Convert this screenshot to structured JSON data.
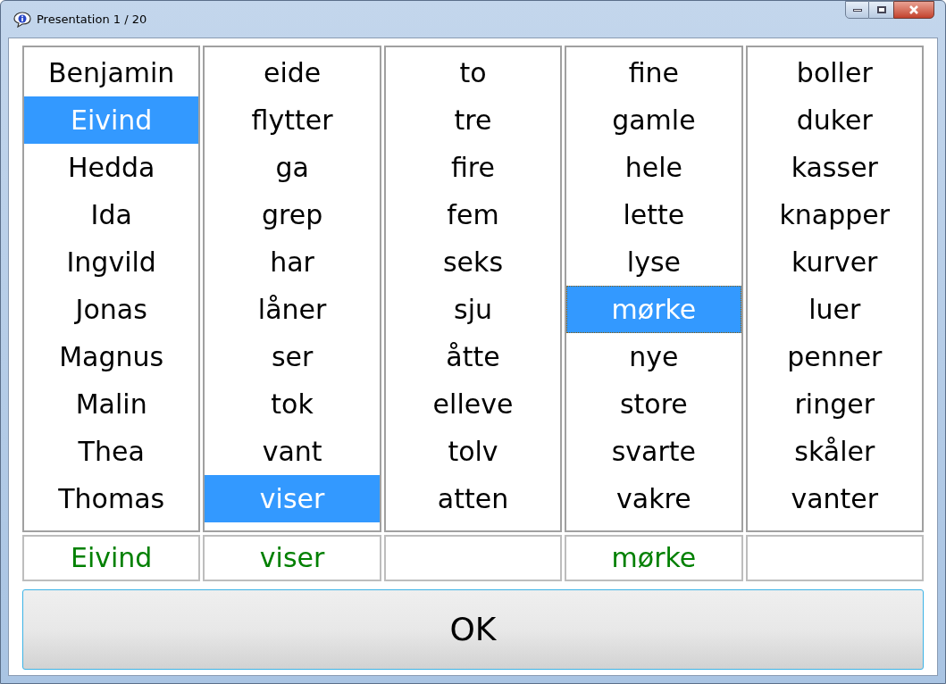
{
  "window": {
    "title": "Presentation 1 / 20"
  },
  "columns": [
    {
      "items": [
        {
          "text": "Benjamin",
          "selected": false,
          "focused": false
        },
        {
          "text": "Eivind",
          "selected": true,
          "focused": false
        },
        {
          "text": "Hedda",
          "selected": false,
          "focused": false
        },
        {
          "text": "Ida",
          "selected": false,
          "focused": false
        },
        {
          "text": "Ingvild",
          "selected": false,
          "focused": false
        },
        {
          "text": "Jonas",
          "selected": false,
          "focused": false
        },
        {
          "text": "Magnus",
          "selected": false,
          "focused": false
        },
        {
          "text": "Malin",
          "selected": false,
          "focused": false
        },
        {
          "text": "Thea",
          "selected": false,
          "focused": false
        },
        {
          "text": "Thomas",
          "selected": false,
          "focused": false
        }
      ],
      "answer": "Eivind"
    },
    {
      "items": [
        {
          "text": "eide",
          "selected": false,
          "focused": false
        },
        {
          "text": "flytter",
          "selected": false,
          "focused": false
        },
        {
          "text": "ga",
          "selected": false,
          "focused": false
        },
        {
          "text": "grep",
          "selected": false,
          "focused": false
        },
        {
          "text": "har",
          "selected": false,
          "focused": false
        },
        {
          "text": "låner",
          "selected": false,
          "focused": false
        },
        {
          "text": "ser",
          "selected": false,
          "focused": false
        },
        {
          "text": "tok",
          "selected": false,
          "focused": false
        },
        {
          "text": "vant",
          "selected": false,
          "focused": false
        },
        {
          "text": "viser",
          "selected": true,
          "focused": false
        }
      ],
      "answer": "viser"
    },
    {
      "items": [
        {
          "text": "to",
          "selected": false,
          "focused": false
        },
        {
          "text": "tre",
          "selected": false,
          "focused": false
        },
        {
          "text": "fire",
          "selected": false,
          "focused": false
        },
        {
          "text": "fem",
          "selected": false,
          "focused": false
        },
        {
          "text": "seks",
          "selected": false,
          "focused": false
        },
        {
          "text": "sju",
          "selected": false,
          "focused": false
        },
        {
          "text": "åtte",
          "selected": false,
          "focused": false
        },
        {
          "text": "elleve",
          "selected": false,
          "focused": false
        },
        {
          "text": "tolv",
          "selected": false,
          "focused": false
        },
        {
          "text": "atten",
          "selected": false,
          "focused": false
        }
      ]
    },
    {
      "items": [
        {
          "text": "fine",
          "selected": false,
          "focused": false
        },
        {
          "text": "gamle",
          "selected": false,
          "focused": false
        },
        {
          "text": "hele",
          "selected": false,
          "focused": false
        },
        {
          "text": "lette",
          "selected": false,
          "focused": false
        },
        {
          "text": "lyse",
          "selected": false,
          "focused": false
        },
        {
          "text": "mørke",
          "selected": true,
          "focused": true
        },
        {
          "text": "nye",
          "selected": false,
          "focused": false
        },
        {
          "text": "store",
          "selected": false,
          "focused": false
        },
        {
          "text": "svarte",
          "selected": false,
          "focused": false
        },
        {
          "text": "vakre",
          "selected": false,
          "focused": false
        }
      ],
      "answer": "mørke"
    },
    {
      "items": [
        {
          "text": "boller",
          "selected": false,
          "focused": false
        },
        {
          "text": "duker",
          "selected": false,
          "focused": false
        },
        {
          "text": "kasser",
          "selected": false,
          "focused": false
        },
        {
          "text": "knapper",
          "selected": false,
          "focused": false
        },
        {
          "text": "kurver",
          "selected": false,
          "focused": false
        },
        {
          "text": "luer",
          "selected": false,
          "focused": false
        },
        {
          "text": "penner",
          "selected": false,
          "focused": false
        },
        {
          "text": "ringer",
          "selected": false,
          "focused": false
        },
        {
          "text": "skåler",
          "selected": false,
          "focused": false
        },
        {
          "text": "vanter",
          "selected": false,
          "focused": false
        }
      ]
    }
  ],
  "ok_button": {
    "label": "OK"
  }
}
